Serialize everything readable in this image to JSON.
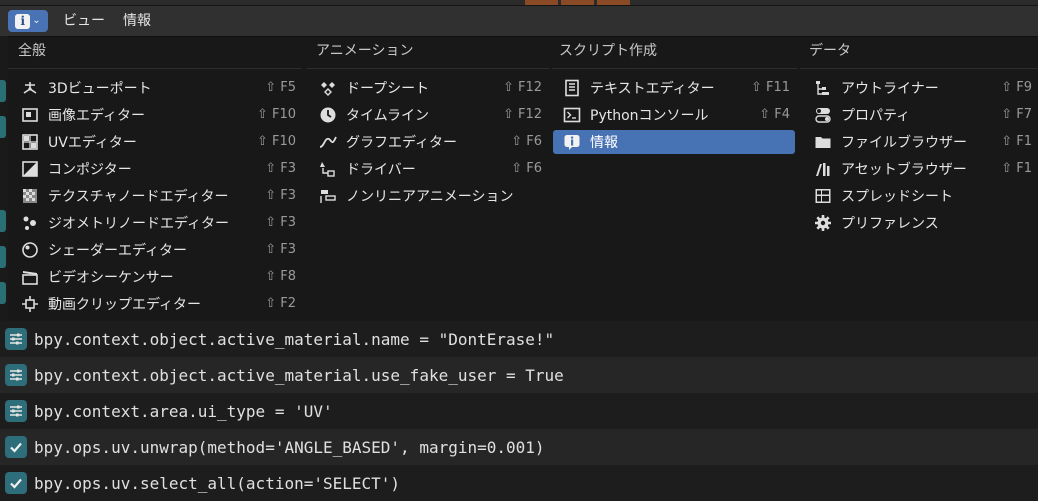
{
  "header": {
    "editor_type_icon": "info-icon",
    "menu": [
      "ビュー",
      "情報"
    ]
  },
  "menu": {
    "columns": [
      {
        "heading": "全般",
        "items": [
          {
            "label": "3Dビューポート",
            "shortcut": "⇧ F5",
            "icon": "viewport-3d-icon"
          },
          {
            "label": "画像エディター",
            "shortcut": "⇧ F10",
            "icon": "image-editor-icon"
          },
          {
            "label": "UVエディター",
            "shortcut": "⇧ F10",
            "icon": "uv-editor-icon"
          },
          {
            "label": "コンポジター",
            "shortcut": "⇧ F3",
            "icon": "compositor-icon"
          },
          {
            "label": "テクスチャノードエディター",
            "shortcut": "⇧ F3",
            "icon": "texture-node-icon"
          },
          {
            "label": "ジオメトリノードエディター",
            "shortcut": "⇧ F3",
            "icon": "geometry-node-icon"
          },
          {
            "label": "シェーダーエディター",
            "shortcut": "⇧ F3",
            "icon": "shader-editor-icon"
          },
          {
            "label": "ビデオシーケンサー",
            "shortcut": "⇧ F8",
            "icon": "video-sequencer-icon"
          },
          {
            "label": "動画クリップエディター",
            "shortcut": "⇧ F2",
            "icon": "movie-clip-icon"
          }
        ]
      },
      {
        "heading": "アニメーション",
        "items": [
          {
            "label": "ドープシート",
            "shortcut": "⇧ F12",
            "icon": "dope-sheet-icon"
          },
          {
            "label": "タイムライン",
            "shortcut": "⇧ F12",
            "icon": "timeline-icon"
          },
          {
            "label": "グラフエディター",
            "shortcut": "⇧ F6",
            "icon": "graph-editor-icon"
          },
          {
            "label": "ドライバー",
            "shortcut": "⇧ F6",
            "icon": "drivers-icon"
          },
          {
            "label": "ノンリニアアニメーション",
            "shortcut": "",
            "icon": "nla-icon"
          }
        ]
      },
      {
        "heading": "スクリプト作成",
        "items": [
          {
            "label": "テキストエディター",
            "shortcut": "⇧ F11",
            "icon": "text-editor-icon"
          },
          {
            "label": "Pythonコンソール",
            "shortcut": "⇧ F4",
            "icon": "python-console-icon"
          },
          {
            "label": "情報",
            "shortcut": "",
            "icon": "info-icon",
            "active": true
          }
        ]
      },
      {
        "heading": "データ",
        "items": [
          {
            "label": "アウトライナー",
            "shortcut": "⇧ F9",
            "icon": "outliner-icon"
          },
          {
            "label": "プロパティ",
            "shortcut": "⇧ F7",
            "icon": "properties-icon"
          },
          {
            "label": "ファイルブラウザー",
            "shortcut": "⇧ F1",
            "icon": "file-browser-icon"
          },
          {
            "label": "アセットブラウザー",
            "shortcut": "⇧ F1",
            "icon": "asset-browser-icon"
          },
          {
            "label": "スプレッドシート",
            "shortcut": "",
            "icon": "spreadsheet-icon"
          },
          {
            "label": "プリファレンス",
            "shortcut": "",
            "icon": "preferences-icon"
          }
        ]
      }
    ]
  },
  "log": [
    {
      "text": "bpy.context.object.active_material.name = \"DontErase!\"",
      "icon": "property-icon"
    },
    {
      "text": "bpy.context.object.active_material.use_fake_user = True",
      "icon": "property-icon"
    },
    {
      "text": "bpy.context.area.ui_type = 'UV'",
      "icon": "property-icon"
    },
    {
      "text": "bpy.ops.uv.unwrap(method='ANGLE_BASED', margin=0.001)",
      "icon": "check-icon"
    },
    {
      "text": "bpy.ops.uv.select_all(action='SELECT')",
      "icon": "check-icon"
    }
  ],
  "colors": {
    "active_item": "#4772b3",
    "log_icon_bg": "#2e6d7a",
    "shortcut_text": "#9a9a9a"
  }
}
